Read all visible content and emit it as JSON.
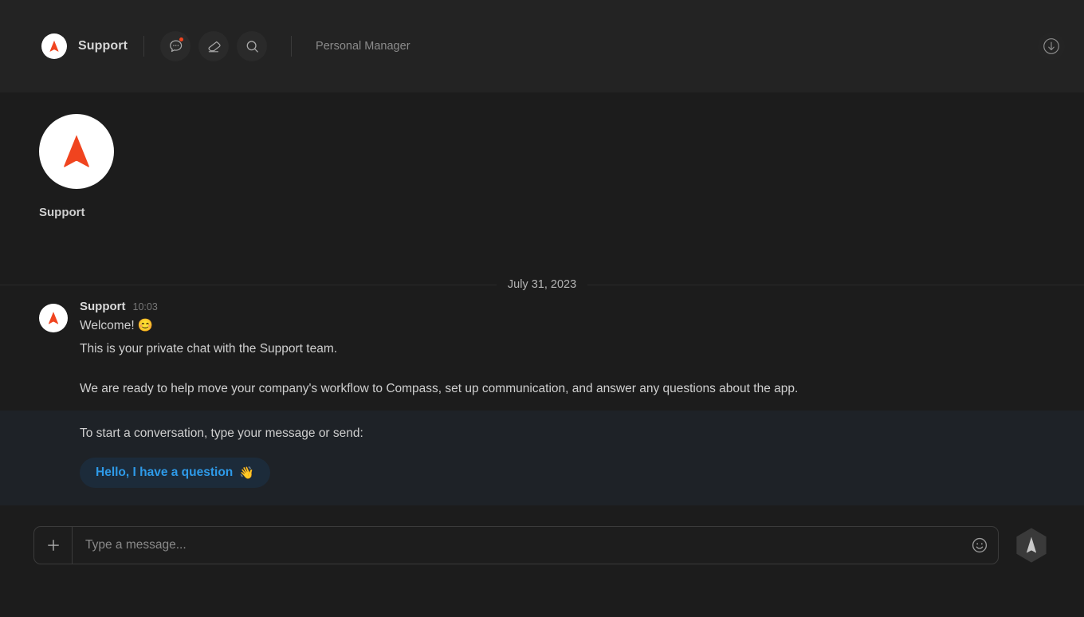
{
  "app": {
    "background_color": "#1c1c1c",
    "accent_color": "#f0441f",
    "link_color": "#2e9ae8"
  },
  "header": {
    "title": "Support",
    "subtitle": "Personal Manager",
    "avatar_icon": "compass-arrow-logo",
    "buttons": [
      {
        "name": "comments-icon",
        "label": "Comments",
        "badge": true
      },
      {
        "name": "eraser-icon",
        "label": "Eraser",
        "badge": false
      },
      {
        "name": "search-icon",
        "label": "Search",
        "badge": false
      }
    ],
    "download_icon": "download-circle-icon"
  },
  "intro": {
    "avatar_icon": "compass-arrow-logo",
    "name": "Support"
  },
  "date_separator": {
    "label": "July 31, 2023"
  },
  "message": {
    "avatar_icon": "compass-arrow-logo",
    "author": "Support",
    "time": "10:03",
    "lines": [
      "Welcome! 😊",
      "This is your private chat with the Support team.",
      "We are ready to help move your company's workflow to Compass, set up communication, and answer any questions about the app."
    ]
  },
  "cta": {
    "prompt": "To start a conversation, type your message or send:",
    "button_label": "Hello, I have a question",
    "button_emoji": "👋"
  },
  "composer": {
    "attach_icon": "plus-icon",
    "placeholder": "Type a message...",
    "value": "",
    "emoji_icon": "smiley-icon",
    "send_icon": "send-arrow-icon"
  }
}
